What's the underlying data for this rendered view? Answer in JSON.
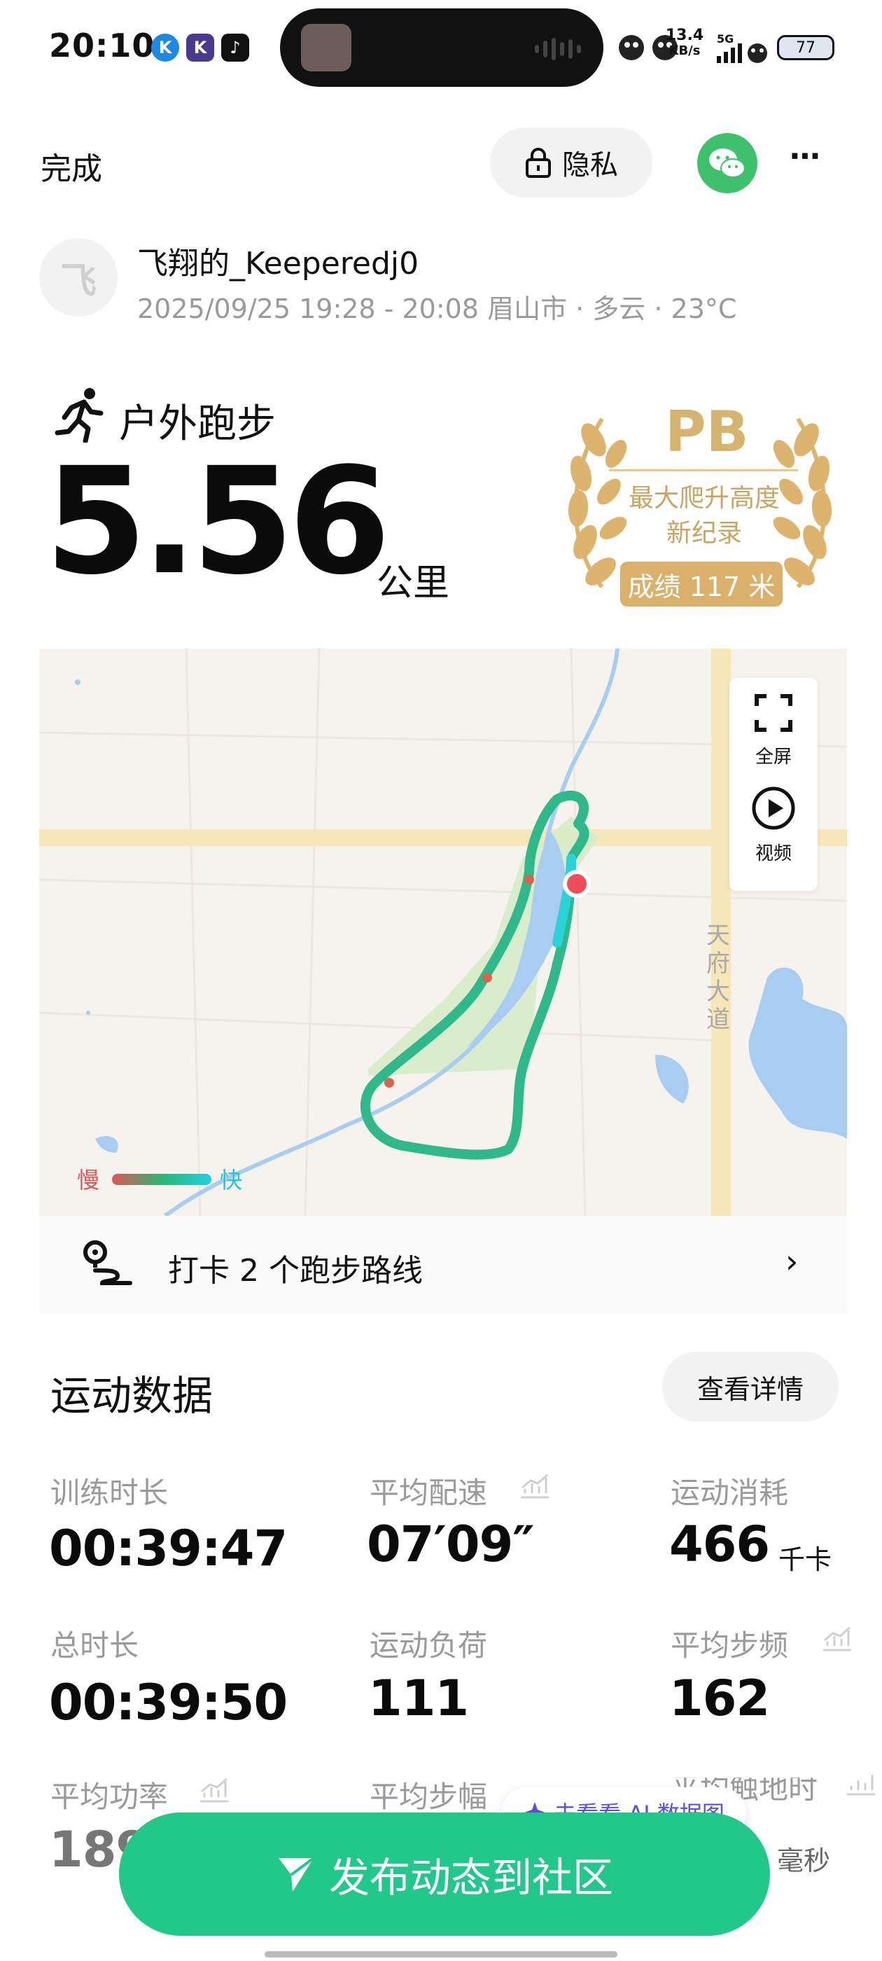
{
  "status_bar": {
    "time": "20:10",
    "app_icons": [
      "K",
      "K",
      "♪"
    ],
    "net_speed_top": "13.4",
    "net_speed_bottom": "KB/s",
    "signal": "5G",
    "battery": "77"
  },
  "header": {
    "done_label": "完成",
    "privacy_label": "隐私",
    "wechat_icon": "wechat-icon",
    "more_label": "⋯"
  },
  "user": {
    "avatar_letter": "飞",
    "name": "飞翔的_Keeperedj0",
    "meta": "2025/09/25 19:28 - 20:08 眉山市 · 多云 · 23°C"
  },
  "activity": {
    "type": "户外跑步",
    "distance": "5.56",
    "unit": "公里"
  },
  "pb_badge": {
    "title": "PB",
    "line1": "最大爬升高度",
    "line2": "新纪录",
    "score": "成绩 117 米",
    "color": "#dbb06a"
  },
  "map": {
    "fullscreen_label": "全屏",
    "video_label": "视频",
    "road_label": "天府大道",
    "legend_slow": "慢",
    "legend_fast": "快",
    "route_checkin": "打卡 2 个跑步路线"
  },
  "data_section": {
    "title": "运动数据",
    "details_button": "查看详情",
    "stats": [
      {
        "label": "训练时长",
        "value": "00:39:47",
        "unit": ""
      },
      {
        "label": "平均配速",
        "value": "07′09″",
        "unit": ""
      },
      {
        "label": "运动消耗",
        "value": "466",
        "unit": "千卡"
      },
      {
        "label": "总时长",
        "value": "00:39:50",
        "unit": ""
      },
      {
        "label": "运动负荷",
        "value": "111",
        "unit": ""
      },
      {
        "label": "平均步频",
        "value": "162",
        "unit": ""
      },
      {
        "label": "平均功率",
        "value": "189",
        "unit": ""
      },
      {
        "label": "平均步幅",
        "value": "",
        "unit": ""
      },
      {
        "label": "平均触地时",
        "value": "",
        "unit": "毫秒"
      }
    ]
  },
  "ai_pill": "去看看 AI 数据图",
  "publish_button": "发布动态到社区",
  "accent_color": "#22c88a"
}
